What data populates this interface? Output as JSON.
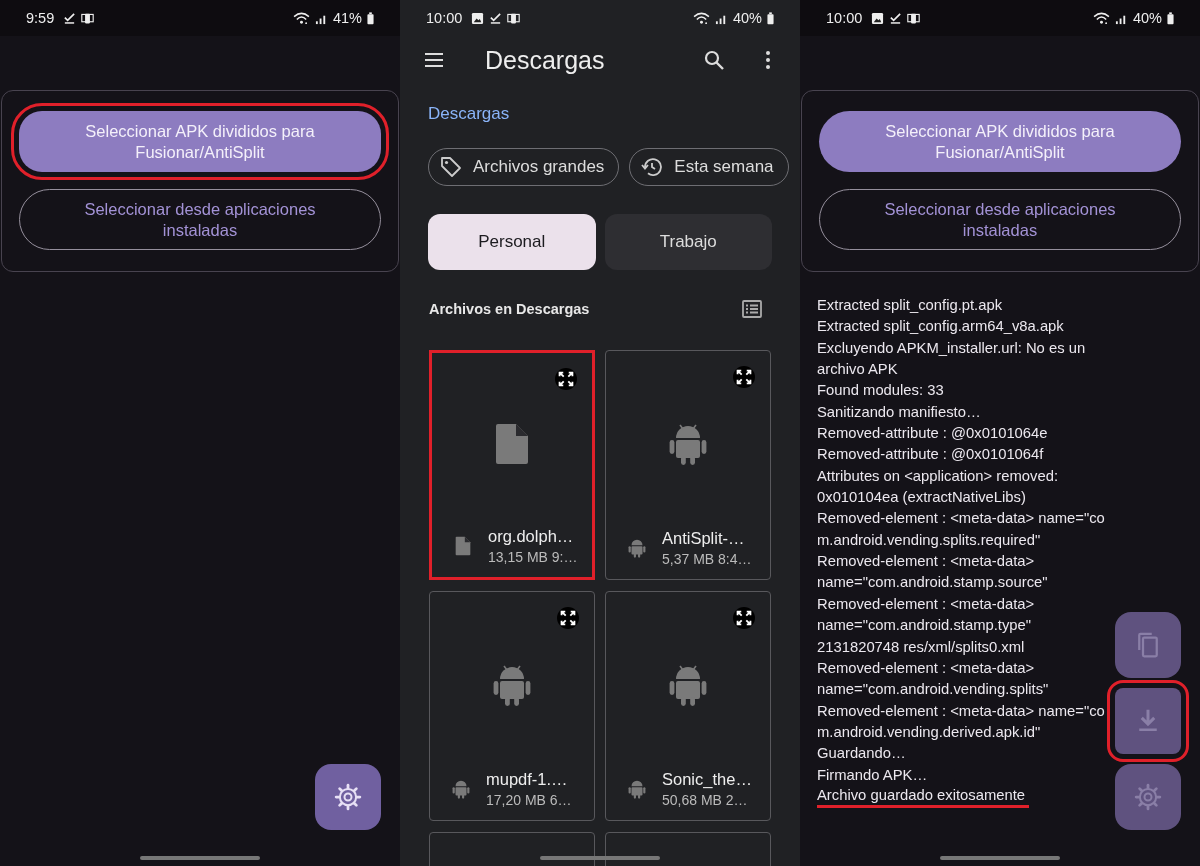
{
  "screens": [
    {
      "kind": "merge",
      "status_bar": {
        "time": "9:59",
        "battery": "41%",
        "icons": [
          {
            "kind": "download"
          },
          {
            "kind": "cast"
          }
        ]
      },
      "primary_button": {
        "label": "Seleccionar APK divididos para Fusionar/AntiSplit",
        "highlighted": true
      },
      "secondary_button": {
        "label": "Seleccionar desde aplicaciones instaladas"
      },
      "fabs": [
        {
          "kind": "settings",
          "highlighted": false
        }
      ]
    },
    {
      "kind": "downloads",
      "status_bar": {
        "time": "10:00",
        "battery": "40%",
        "icons": [
          {
            "kind": "image"
          },
          {
            "kind": "download"
          },
          {
            "kind": "cast"
          }
        ]
      },
      "title": "Descargas",
      "breadcrumb": "Descargas",
      "chips": [
        {
          "label": "Archivos grandes",
          "kind": "tag"
        },
        {
          "label": "Esta semana",
          "kind": "history"
        }
      ],
      "tabs": [
        {
          "label": "Personal",
          "selected": true
        },
        {
          "label": "Trabajo",
          "selected": false
        }
      ],
      "section_title": "Archivos en Descargas",
      "files": [
        {
          "name": "org.dolph…",
          "meta": "13,15 MB 9:…",
          "kind": "document",
          "highlighted": true
        },
        {
          "name": "AntiSplit-…",
          "meta": "5,37 MB 8:4…",
          "kind": "android",
          "highlighted": false
        },
        {
          "name": "mupdf-1.…",
          "meta": "17,20 MB 6…",
          "kind": "android",
          "highlighted": false
        },
        {
          "name": "Sonic_the…",
          "meta": "50,68 MB 2…",
          "kind": "android",
          "highlighted": false
        }
      ]
    },
    {
      "kind": "result",
      "status_bar": {
        "time": "10:00",
        "battery": "40%",
        "icons": [
          {
            "kind": "image"
          },
          {
            "kind": "download"
          },
          {
            "kind": "cast"
          }
        ]
      },
      "primary_button": {
        "label": "Seleccionar APK divididos para Fusionar/AntiSplit",
        "highlighted": false
      },
      "secondary_button": {
        "label": "Seleccionar desde aplicaciones instaladas"
      },
      "log": [
        {
          "text": "Extracted split_config.pt.apk",
          "highlighted": false
        },
        {
          "text": "Extracted split_config.arm64_v8a.apk",
          "highlighted": false
        },
        {
          "text": "Excluyendo APKM_installer.url: No es un",
          "highlighted": false
        },
        {
          "text": "archivo APK",
          "highlighted": false
        },
        {
          "text": "Found modules: 33",
          "highlighted": false
        },
        {
          "text": "Sanitizando manifiesto…",
          "highlighted": false
        },
        {
          "text": "Removed-attribute : @0x0101064e",
          "highlighted": false
        },
        {
          "text": "Removed-attribute : @0x0101064f",
          "highlighted": false
        },
        {
          "text": "Attributes on <application> removed:",
          "highlighted": false
        },
        {
          "text": "0x010104ea (extractNativeLibs)",
          "highlighted": false
        },
        {
          "text": "Removed-element : <meta-data> name=\"co",
          "highlighted": false
        },
        {
          "text": "m.android.vending.splits.required\"",
          "highlighted": false
        },
        {
          "text": "Removed-element : <meta-data>",
          "highlighted": false
        },
        {
          "text": "name=\"com.android.stamp.source\"",
          "highlighted": false
        },
        {
          "text": "Removed-element : <meta-data>",
          "highlighted": false
        },
        {
          "text": "name=\"com.android.stamp.type\"",
          "highlighted": false
        },
        {
          "text": "2131820748 res/xml/splits0.xml",
          "highlighted": false
        },
        {
          "text": "Removed-element : <meta-data>",
          "highlighted": false
        },
        {
          "text": "name=\"com.android.vending.splits\"",
          "highlighted": false
        },
        {
          "text": "Removed-element : <meta-data> name=\"co",
          "highlighted": false
        },
        {
          "text": "m.android.vending.derived.apk.id\"",
          "highlighted": false
        },
        {
          "text": "Guardando…",
          "highlighted": false
        },
        {
          "text": "Firmando APK…",
          "highlighted": false
        },
        {
          "text": "Archivo guardado exitosamente",
          "highlighted": true
        }
      ],
      "fabs": [
        {
          "kind": "copy",
          "highlighted": false
        },
        {
          "kind": "save",
          "highlighted": true
        },
        {
          "kind": "settings",
          "highlighted": false
        }
      ]
    }
  ]
}
